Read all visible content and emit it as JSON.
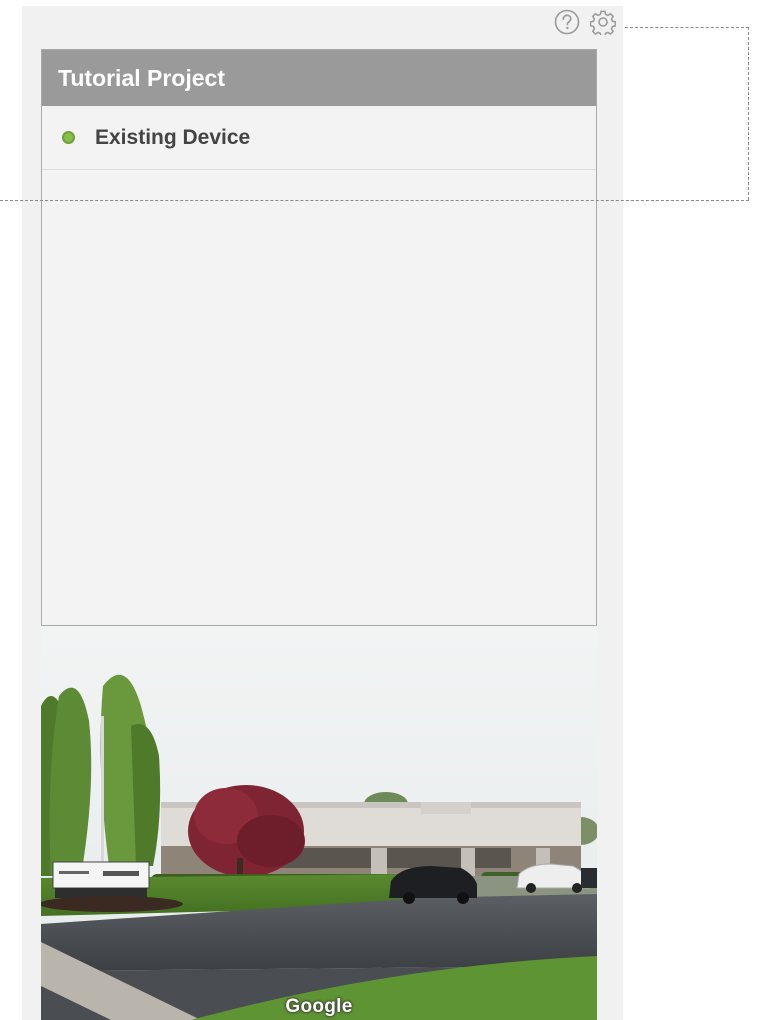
{
  "sidebar": {
    "help_icon": "help-icon",
    "settings_icon": "gear-icon",
    "project": {
      "title": "Tutorial Project",
      "devices": [
        {
          "label": "Existing Device",
          "status_color": "#88bf4c"
        }
      ]
    },
    "street_view": {
      "attribution": "Google"
    }
  },
  "colors": {
    "header_bg": "#9a9a9a",
    "panel_bg": "#f1f1f1",
    "status_green": "#88bf4c"
  }
}
